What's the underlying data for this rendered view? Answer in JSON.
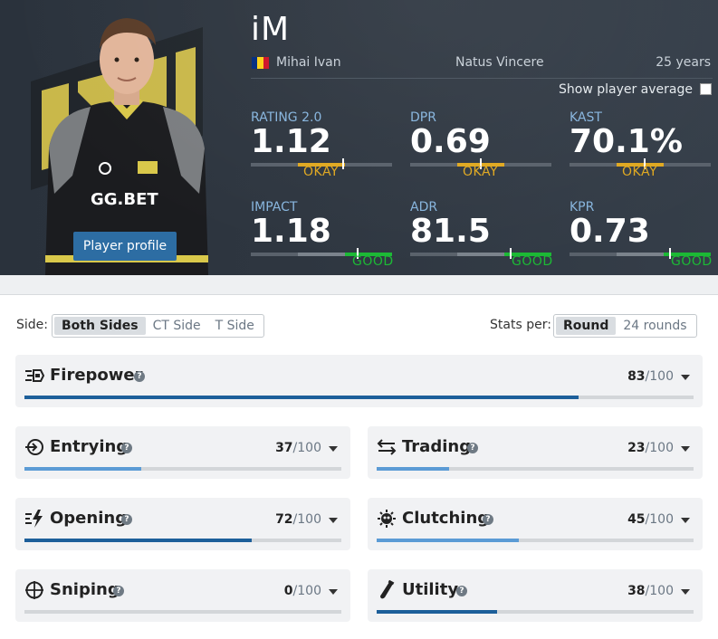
{
  "player": {
    "nickname": "iM",
    "real_name": "Mihai Ivan",
    "team": "Natus Vincere",
    "age": "25 years",
    "profile_button": "Player profile",
    "show_average_label": "Show player average",
    "flag_colors": [
      "#002b7f",
      "#fcd116",
      "#ce1126"
    ]
  },
  "stats": [
    {
      "label": "RATING 2.0",
      "value": "1.12",
      "rating": "OKAY",
      "level": 0.68
    },
    {
      "label": "DPR",
      "value": "0.69",
      "rating": "OKAY",
      "level": 0.5
    },
    {
      "label": "KAST",
      "value": "70.1%",
      "rating": "OKAY",
      "level": 0.53
    },
    {
      "label": "IMPACT",
      "value": "1.18",
      "rating": "GOOD",
      "level": 0.75
    },
    {
      "label": "ADR",
      "value": "81.5",
      "rating": "GOOD",
      "level": 0.7
    },
    {
      "label": "KPR",
      "value": "0.73",
      "rating": "GOOD",
      "level": 0.71
    }
  ],
  "filters": {
    "side_label": "Side:",
    "side_options": [
      "Both Sides",
      "CT Side",
      "T Side"
    ],
    "side_selected": "Both Sides",
    "per_label": "Stats per:",
    "per_options": [
      "Round",
      "24 rounds"
    ],
    "per_selected": "Round"
  },
  "categories": [
    {
      "name": "Firepower",
      "score": "83",
      "max": "/100",
      "icon": "firepower-icon",
      "value": 0.83
    },
    {
      "name": "Entrying",
      "score": "37",
      "max": "/100",
      "icon": "entrying-icon",
      "value": 0.37
    },
    {
      "name": "Trading",
      "score": "23",
      "max": "/100",
      "icon": "trading-icon",
      "value": 0.23
    },
    {
      "name": "Opening",
      "score": "72",
      "max": "/100",
      "icon": "opening-icon",
      "value": 0.72
    },
    {
      "name": "Clutching",
      "score": "45",
      "max": "/100",
      "icon": "clutching-icon",
      "value": 0.45
    },
    {
      "name": "Sniping",
      "score": "0",
      "max": "/100",
      "icon": "sniping-icon",
      "value": 0.0
    },
    {
      "name": "Utility",
      "score": "38",
      "max": "/100",
      "icon": "utility-icon",
      "value": 0.38
    }
  ],
  "colors": {
    "okay": "#e0a820",
    "good": "#1cb935",
    "bar_dark": "#1d5f9a",
    "bar_light": "#5b9bd5",
    "accent": "#2d6da3"
  }
}
